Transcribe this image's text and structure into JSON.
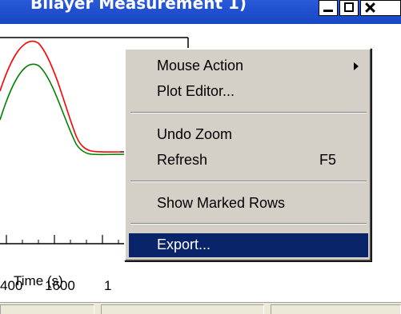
{
  "window": {
    "title": "Bilayer Measurement 1)"
  },
  "plot": {
    "tick_labels": [
      "400",
      "1600",
      "1"
    ],
    "xlabel": "Time (s)",
    "series_colors": {
      "red": "#ff0000",
      "green": "#008000"
    }
  },
  "context_menu": {
    "items": [
      {
        "label": "Mouse Action",
        "submenu": true
      },
      {
        "label": "Plot Editor..."
      },
      {
        "label": "Undo Zoom"
      },
      {
        "label": "Refresh",
        "shortcut": "F5"
      },
      {
        "label": "Show Marked Rows"
      },
      {
        "label": "Export...",
        "highlighted": true
      }
    ]
  },
  "colors": {
    "titlebar": "#1e4fcf",
    "menu_bg": "#d4d0c8",
    "highlight": "#0a246a"
  }
}
